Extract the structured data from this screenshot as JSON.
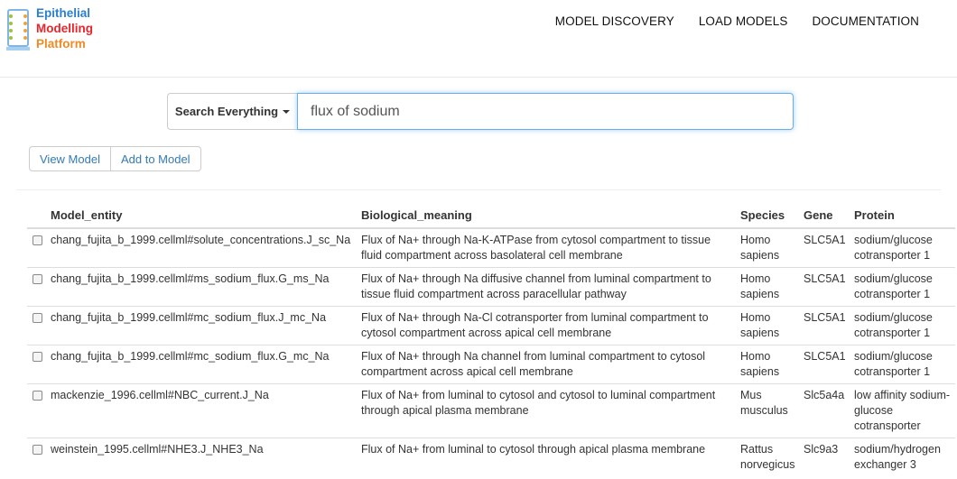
{
  "brand": {
    "line1": "Epithelial",
    "line2": "Modelling",
    "line3": "Platform"
  },
  "nav": [
    "MODEL DISCOVERY",
    "LOAD MODELS",
    "DOCUMENTATION"
  ],
  "search": {
    "dropdown_label": "Search Everything",
    "query": "flux of sodium"
  },
  "actions": {
    "view_label": "View Model",
    "add_label": "Add to Model"
  },
  "table": {
    "headers": [
      "Model_entity",
      "Biological_meaning",
      "Species",
      "Gene",
      "Protein"
    ],
    "rows": [
      {
        "entity": "chang_fujita_b_1999.cellml#solute_concentrations.J_sc_Na",
        "meaning": "Flux of Na+ through Na-K-ATPase from cytosol compartment to tissue fluid compartment across basolateral cell membrane",
        "species": "Homo sapiens",
        "gene": "SLC5A1",
        "protein": "sodium/glucose cotransporter 1"
      },
      {
        "entity": "chang_fujita_b_1999.cellml#ms_sodium_flux.G_ms_Na",
        "meaning": "Flux of Na+ through Na diffusive channel from luminal compartment to tissue fluid compartment across paracellular pathway",
        "species": "Homo sapiens",
        "gene": "SLC5A1",
        "protein": "sodium/glucose cotransporter 1"
      },
      {
        "entity": "chang_fujita_b_1999.cellml#mc_sodium_flux.J_mc_Na",
        "meaning": "Flux of Na+ through Na-Cl cotransporter from luminal compartment to cytosol compartment across apical cell membrane",
        "species": "Homo sapiens",
        "gene": "SLC5A1",
        "protein": "sodium/glucose cotransporter 1"
      },
      {
        "entity": "chang_fujita_b_1999.cellml#mc_sodium_flux.G_mc_Na",
        "meaning": "Flux of Na+ through Na channel from luminal compartment to cytosol compartment across apical cell membrane",
        "species": "Homo sapiens",
        "gene": "SLC5A1",
        "protein": "sodium/glucose cotransporter 1"
      },
      {
        "entity": "mackenzie_1996.cellml#NBC_current.J_Na",
        "meaning": "Flux of Na+ from luminal to cytosol and cytosol to luminal compartment through apical plasma membrane",
        "species": "Mus musculus",
        "gene": "Slc5a4a",
        "protein": "low affinity sodium-glucose cotransporter"
      },
      {
        "entity": "weinstein_1995.cellml#NHE3.J_NHE3_Na",
        "meaning": "Flux of Na+ from luminal to cytosol through apical plasma membrane",
        "species": "Rattus norvegicus",
        "gene": "Slc9a3",
        "protein": "sodium/hydrogen exchanger 3"
      }
    ]
  }
}
